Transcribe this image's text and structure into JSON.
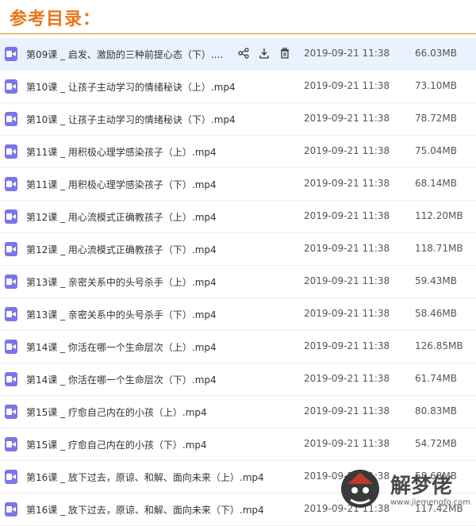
{
  "header": {
    "title": "参考目录："
  },
  "files": [
    {
      "name": "第09课 _ 启发、激励的三种前提心态（下）....",
      "date": "2019-09-21 11:38",
      "size": "66.03MB"
    },
    {
      "name": "第10课 _ 让孩子主动学习的情绪秘诀（上）.mp4",
      "date": "2019-09-21 11:38",
      "size": "73.10MB"
    },
    {
      "name": "第10课 _ 让孩子主动学习的情绪秘诀（下）.mp4",
      "date": "2019-09-21 11:38",
      "size": "78.72MB"
    },
    {
      "name": "第11课 _ 用积极心理学感染孩子（上）.mp4",
      "date": "2019-09-21 11:38",
      "size": "75.04MB"
    },
    {
      "name": "第11课 _ 用积极心理学感染孩子（下）.mp4",
      "date": "2019-09-21 11:38",
      "size": "68.14MB"
    },
    {
      "name": "第12课 _ 用心流模式正确教孩子（上）.mp4",
      "date": "2019-09-21 11:38",
      "size": "112.20MB"
    },
    {
      "name": "第12课 _ 用心流模式正确教孩子（下）.mp4",
      "date": "2019-09-21 11:38",
      "size": "118.71MB"
    },
    {
      "name": "第13课 _ 亲密关系中的头号杀手（上）.mp4",
      "date": "2019-09-21 11:38",
      "size": "59.43MB"
    },
    {
      "name": "第13课 _ 亲密关系中的头号杀手（下）.mp4",
      "date": "2019-09-21 11:38",
      "size": "58.46MB"
    },
    {
      "name": "第14课 _ 你活在哪一个生命层次（上）.mp4",
      "date": "2019-09-21 11:38",
      "size": "126.85MB"
    },
    {
      "name": "第14课 _ 你活在哪一个生命层次（下）.mp4",
      "date": "2019-09-21 11:38",
      "size": "61.74MB"
    },
    {
      "name": "第15课 _ 疗愈自己内在的小孩（上）.mp4",
      "date": "2019-09-21 11:38",
      "size": "80.83MB"
    },
    {
      "name": "第15课 _ 疗愈自己内在的小孩（下）.mp4",
      "date": "2019-09-21 11:38",
      "size": "54.72MB"
    },
    {
      "name": "第16课 _ 放下过去，原谅、和解、面向未来（上）.mp4",
      "date": "2019-09-21 11:38",
      "size": "58.68MB"
    },
    {
      "name": "第16课 _ 放下过去，原谅、和解、面向未来（下）.mp4",
      "date": "2019-09-21 11:38",
      "size": "117.42MB"
    }
  ],
  "selected_index": 0,
  "row_actions": [
    {
      "name": "share-icon"
    },
    {
      "name": "download-icon"
    },
    {
      "name": "delete-icon"
    }
  ],
  "watermark": {
    "text": "解梦佬",
    "url": "www.jiemengfo.com"
  },
  "colors": {
    "accent": "#e8761b",
    "file_icon": "#7b76e8",
    "selected_row": "#e9f3fd"
  }
}
